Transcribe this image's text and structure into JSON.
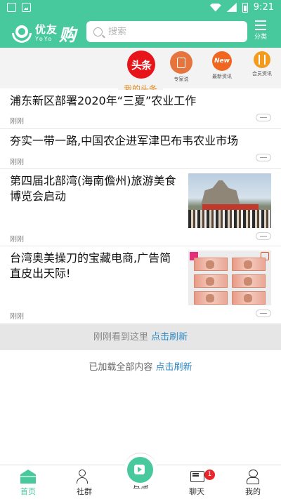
{
  "status_bar": {
    "time": "9:21"
  },
  "header": {
    "logo_cn": "优友",
    "logo_en": "YoYo",
    "logo_gou": "购",
    "search_placeholder": "搜索",
    "category_label": "分类"
  },
  "channels": [
    {
      "label": "头条",
      "caption": "我的头条"
    },
    {
      "label": "专家说",
      "icon": "document-icon"
    },
    {
      "label": "最新资讯",
      "badge": "New"
    },
    {
      "label": "会员资讯",
      "icon": "fork-spoon-icon"
    }
  ],
  "news": [
    {
      "title": "浦东新区部署2020年“三夏”农业工作",
      "time": "刚刚"
    },
    {
      "title": "夯实一带一路,中国农企进军津巴布韦农业市场",
      "time": "刚刚"
    },
    {
      "title": "第四届北部湾(海南儋州)旅游美食博览会启动",
      "time": "刚刚",
      "image": "expo-ceremony-photo"
    },
    {
      "title": "台湾奥美操刀的宝藏电商,广告简直皮出天际!",
      "time": "刚刚",
      "image": "banknotes-photo"
    }
  ],
  "refresh_bar": {
    "text": "刚刚看到这里",
    "link": "点击刷新"
  },
  "loaded": {
    "text": "已加载全部内容",
    "link": "点击刷新"
  },
  "tabbar": {
    "home": "首页",
    "group": "社群",
    "live": "直播",
    "chat": "聊天",
    "chat_badge": "1",
    "mine": "我的",
    "active": "home"
  },
  "colors": {
    "brand": "#47c99d",
    "toutiao_red": "#e7141a",
    "link": "#2f89c7",
    "badge_red": "#e8262b"
  }
}
